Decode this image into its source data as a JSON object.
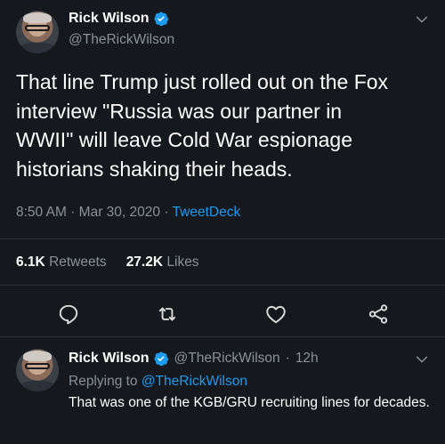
{
  "main": {
    "author_name": "Rick Wilson",
    "author_handle": "@TheRickWilson",
    "text_lines": [
      "That line Trump just rolled out on the Fox",
      "interview \"Russia was our partner in",
      "WWII\" will leave Cold War espionage",
      "historians shaking their heads."
    ],
    "time": "8:50 AM",
    "date": "Mar 30, 2020",
    "source": "TweetDeck",
    "separator": "·",
    "retweets_count": "6.1K",
    "retweets_label": "Retweets",
    "likes_count": "27.2K",
    "likes_label": "Likes"
  },
  "reply": {
    "author_name": "Rick Wilson",
    "author_handle": "@TheRickWilson",
    "age": "12h",
    "separator": "·",
    "replying_prefix": "Replying to",
    "replying_handle": "@TheRickWilson",
    "text": "That was one of the KGB/GRU recruiting lines for decades."
  },
  "icons": {
    "verified": "verified-badge-icon",
    "caret": "chevron-down-icon",
    "reply": "reply-icon",
    "retweet": "retweet-icon",
    "like": "heart-icon",
    "share": "share-icon"
  },
  "colors": {
    "background": "#15181c",
    "accent": "#1d9bf0",
    "muted": "#8a9199",
    "text": "#ffffff"
  }
}
